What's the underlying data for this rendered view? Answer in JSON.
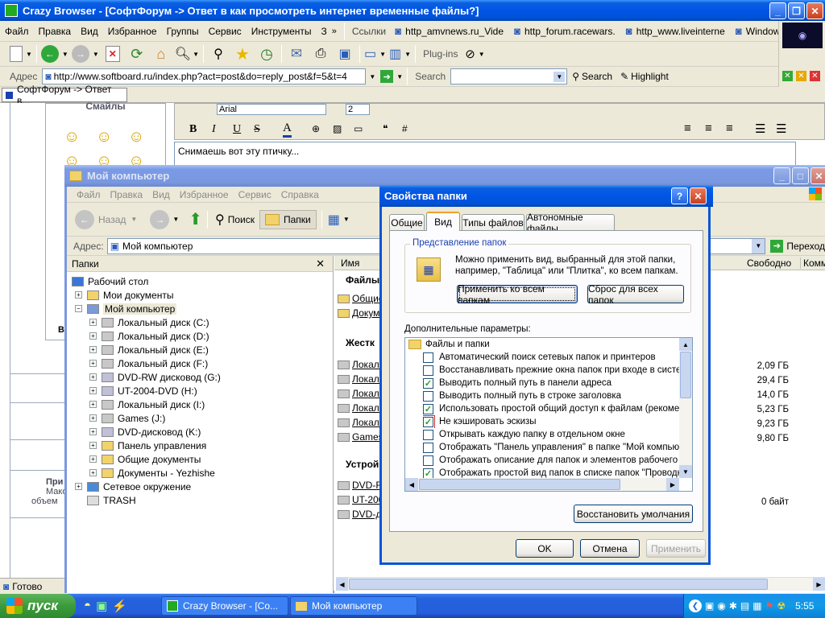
{
  "browser": {
    "title": "Crazy Browser - [СофтФорум -> Ответ в как просмотреть интернет временные файлы?]",
    "menu": [
      "Файл",
      "Правка",
      "Вид",
      "Избранное",
      "Группы",
      "Сервис",
      "Инструменты",
      "З"
    ],
    "links_label": "Ссылки",
    "links": [
      "http_amvnews.ru_Vide",
      "http_forum.racewars.",
      "http_www.liveinterne",
      "Windows"
    ],
    "plugins_label": "Plug-ins",
    "address_label": "Адрес",
    "address_value": "http://www.softboard.ru/index.php?act=post&do=reply_post&f=5&t=4",
    "search_label": "Search",
    "search_button": "Search",
    "highlight_button": "Highlight",
    "tab_label": "СофтФорум -> Ответ в...",
    "status_text": "Готово"
  },
  "forum": {
    "smiles_label": "Смайлы",
    "font_name": "Arial",
    "font_size": "2",
    "editor_text": "Снимаешь вот эту птичку...",
    "side_text1": "При",
    "side_text2": "Мако",
    "side_text3": "объем",
    "side_letter": "В"
  },
  "explorer": {
    "title": "Мой компьютер",
    "menu": [
      "Файл",
      "Правка",
      "Вид",
      "Избранное",
      "Сервис",
      "Справка"
    ],
    "back_label": "Назад",
    "search_label": "Поиск",
    "folders_label": "Папки",
    "address_label": "Адрес:",
    "address_value": "Мой компьютер",
    "go_label": "Переход",
    "folders_pane_title": "Папки",
    "tree": [
      {
        "label": "Рабочий стол",
        "level": 0,
        "exp": ""
      },
      {
        "label": "Мои документы",
        "level": 1,
        "exp": "+"
      },
      {
        "label": "Мой компьютер",
        "level": 1,
        "exp": "-"
      },
      {
        "label": "Локальный диск (C:)",
        "level": 2,
        "exp": "+"
      },
      {
        "label": "Локальный диск (D:)",
        "level": 2,
        "exp": "+"
      },
      {
        "label": "Локальный диск (E:)",
        "level": 2,
        "exp": "+"
      },
      {
        "label": "Локальный диск (F:)",
        "level": 2,
        "exp": "+"
      },
      {
        "label": "DVD-RW дисковод (G:)",
        "level": 2,
        "exp": "+"
      },
      {
        "label": "UT-2004-DVD (H:)",
        "level": 2,
        "exp": "+"
      },
      {
        "label": "Локальный диск (I:)",
        "level": 2,
        "exp": "+"
      },
      {
        "label": "Games (J:)",
        "level": 2,
        "exp": "+"
      },
      {
        "label": "DVD-дисковод (K:)",
        "level": 2,
        "exp": "+"
      },
      {
        "label": "Панель управления",
        "level": 2,
        "exp": "+"
      },
      {
        "label": "Общие документы",
        "level": 2,
        "exp": "+"
      },
      {
        "label": "Документы - Yezhishe",
        "level": 2,
        "exp": "+"
      },
      {
        "label": "Сетевое окружение",
        "level": 1,
        "exp": "+"
      },
      {
        "label": "TRASH",
        "level": 1,
        "exp": ""
      }
    ],
    "col_name": "Имя",
    "col_free": "Свободно",
    "col_comment": "Комме",
    "group_files": "Файлы,",
    "group_disks": "Жестк",
    "group_devices": "Устрой",
    "files": [
      "Общие",
      "Докум"
    ],
    "disks": [
      "Локаль",
      "Локаль",
      "Локаль",
      "Локаль",
      "Локаль",
      "Games"
    ],
    "devices": [
      "DVD-RV",
      "UT-200",
      "DVD-ди"
    ],
    "sizes": [
      "2,09 ГБ",
      "29,4 ГБ",
      "14,0 ГБ",
      "5,23 ГБ",
      "9,23 ГБ",
      "9,80 ГБ"
    ],
    "device_size": "0 байт"
  },
  "dialog": {
    "title": "Свойства папки",
    "tabs": [
      "Общие",
      "Вид",
      "Типы файлов",
      "Автономные файлы"
    ],
    "group_title": "Представление папок",
    "group_text": "Можно применить вид, выбранный для этой папки, например, \"Таблица\" или \"Плитка\", ко всем папкам.",
    "apply_all": "Применить ко всем папкам",
    "reset_all": "Сброс для всех папок",
    "advanced_label": "Дополнительные параметры:",
    "folder_node": "Файлы и папки",
    "options": [
      {
        "label": "Автоматический поиск сетевых папок и принтеров",
        "checked": false
      },
      {
        "label": "Восстанавливать прежние окна папок при входе в систему",
        "checked": false
      },
      {
        "label": "Выводить полный путь в панели адреса",
        "checked": true
      },
      {
        "label": "Выводить полный путь в строке заголовка",
        "checked": false
      },
      {
        "label": "Использовать простой общий доступ к файлам (рекомендуется)",
        "checked": true
      },
      {
        "label": "Не кэшировать эскизы",
        "checked": true
      },
      {
        "label": "Открывать каждую папку в отдельном окне",
        "checked": false
      },
      {
        "label": "Отображать \"Панель управления\" в папке \"Мой компьютер\"",
        "checked": false
      },
      {
        "label": "Отображать описание для папок и элементов рабочего стола",
        "checked": false
      },
      {
        "label": "Отображать простой вид папок в списке папок \"Проводника\"",
        "checked": true
      }
    ],
    "restore_defaults": "Восстановить умолчания",
    "ok": "OK",
    "cancel": "Отмена",
    "apply": "Применить",
    "help": "?"
  },
  "taskbar": {
    "start": "пуск",
    "tasks": [
      "Crazy Browser - [Со...",
      "Мой компьютер"
    ],
    "clock": "5:55"
  }
}
